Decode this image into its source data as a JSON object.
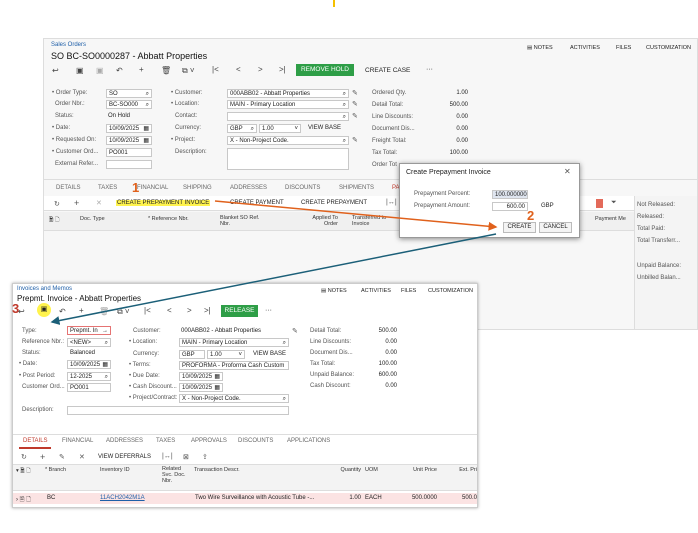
{
  "top_marker_color": "#f5c000",
  "so": {
    "breadcrumb": "Sales Orders",
    "title": "SO BC-SO0000287 - Abbatt Properties",
    "top_menu": [
      "NOTES",
      "ACTIVITIES",
      "FILES",
      "CUSTOMIZATION"
    ],
    "toolbar": {
      "remove_hold": "REMOVE HOLD",
      "create_case": "CREATE CASE",
      "more": "···"
    },
    "fields_left": {
      "order_type_label": "Order Type:",
      "order_type": "SO",
      "order_nbr_label": "Order Nbr.:",
      "order_nbr": "BC-SO000",
      "status_label": "Status:",
      "status": "On Hold",
      "date_label": "Date:",
      "date": "10/09/2025",
      "requested_on_label": "Requested On:",
      "requested_on": "10/09/2025",
      "customer_ord_label": "Customer Ord...",
      "customer_ord": "PO001",
      "external_refer_label": "External Refer..."
    },
    "fields_mid": {
      "customer_label": "Customer:",
      "customer": "000ABB02 - Abbatt Properties",
      "location_label": "Location:",
      "location": "MAIN - Primary Location",
      "contact_label": "Contact:",
      "currency_label": "Currency:",
      "currency": "GBP",
      "rate": "1.00",
      "view_base": "VIEW BASE",
      "project_label": "Project:",
      "project": "X - Non-Project Code.",
      "description_label": "Description:"
    },
    "fields_right": {
      "ordered_qty_label": "Ordered Qty.",
      "ordered_qty": "1.00",
      "detail_total_label": "Detail Total:",
      "detail_total": "500.00",
      "line_discounts_label": "Line Discounts:",
      "line_discounts": "0.00",
      "document_dis_label": "Document Dis...",
      "document_dis": "0.00",
      "freight_total_label": "Freight Total:",
      "freight_total": "0.00",
      "tax_total_label": "Tax Total:",
      "tax_total": "100.00",
      "order_total_label": "Order Tot"
    },
    "tabs": [
      "DETAILS",
      "TAXES",
      "FINANCIAL",
      "SHIPPING",
      "ADDRESSES",
      "DISCOUNTS",
      "SHIPMENTS",
      "PA"
    ],
    "grid_toolbar": {
      "create_prepayment_invoice": "CREATE PREPAYMENT INVOICE",
      "create_payment": "CREATE PAYMENT",
      "create_prepayment": "CREATE PREPAYMENT"
    },
    "grid_headers": [
      "Doc. Type",
      "* Reference Nbr.",
      "Blanket SO Ref. Nbr.",
      "Applied To Order",
      "Transferred to Invoice",
      "Payment Me"
    ],
    "right_panel": [
      "Not Released:",
      "Released:",
      "Total Paid:",
      "Total Transferr...",
      "Unpaid Balance:",
      "Unbilled Balan..."
    ]
  },
  "dialog": {
    "title": "Create Prepayment Invoice",
    "percent_label": "Prepayment Percent:",
    "percent": "100.000000",
    "amount_label": "Prepayment Amount:",
    "amount": "600.00",
    "currency": "GBP",
    "create": "CREATE",
    "cancel": "CANCEL"
  },
  "steps": {
    "s1": "1",
    "s2": "2",
    "s3": "3"
  },
  "pi": {
    "breadcrumb": "Invoices and Memos",
    "title": "Prepmt. Invoice - Abbatt Properties",
    "top_menu": [
      "NOTES",
      "ACTIVITIES",
      "FILES",
      "CUSTOMIZATION"
    ],
    "release": "RELEASE",
    "more": "···",
    "fields_left": {
      "type_label": "Type:",
      "type": "Prepmt. In",
      "ref_label": "Reference Nbr.:",
      "ref": "<NEW>",
      "status_label": "Status:",
      "status": "Balanced",
      "date_label": "Date:",
      "date": "10/09/2025",
      "post_period_label": "Post Period:",
      "post_period": "12-2025",
      "customer_ord_label": "Customer Ord...",
      "customer_ord": "PO001",
      "description_label": "Description:"
    },
    "fields_mid": {
      "customer_label": "Customer:",
      "customer": "000ABB02 - Abbatt Properties",
      "location_label": "Location:",
      "location": "MAIN - Primary Location",
      "currency_label": "Currency:",
      "currency": "GBP",
      "rate": "1.00",
      "view_base": "VIEW BASE",
      "terms_label": "Terms:",
      "terms": "PROFORMA - Proforma Cash Custom",
      "due_date_label": "Due Date:",
      "due_date": "10/09/2025",
      "cash_discount_label": "Cash Discount...",
      "cash_discount": "10/09/2025",
      "project_label": "Project/Contract:",
      "project": "X - Non-Project Code."
    },
    "fields_right": {
      "detail_total_label": "Detail Total:",
      "detail_total": "500.00",
      "line_discounts_label": "Line Discounts:",
      "line_discounts": "0.00",
      "document_dis_label": "Document Dis...",
      "document_dis": "0.00",
      "tax_total_label": "Tax Total:",
      "tax_total": "100.00",
      "unpaid_balance_label": "Unpaid Balance:",
      "unpaid_balance": "600.00",
      "cash_discount_label": "Cash Discount:",
      "cash_discount": "0.00"
    },
    "tabs": [
      "DETAILS",
      "FINANCIAL",
      "ADDRESSES",
      "TAXES",
      "APPROVALS",
      "DISCOUNTS",
      "APPLICATIONS"
    ],
    "view_deferrals": "VIEW DEFERRALS",
    "grid_headers": [
      "* Branch",
      "Inventory ID",
      "Related Svc. Doc. Nbr.",
      "Transaction Descr.",
      "Quantity",
      "UOM",
      "Unit Price",
      "Ext. Pri"
    ],
    "row": {
      "branch": "BC",
      "inventory_id": "11ACH2042M1A",
      "descr": "Two Wire Surveillance with Acoustic Tube -...",
      "qty": "1.00",
      "uom": "EACH",
      "unit_price": "500.0000",
      "ext_price": "500.0"
    }
  }
}
